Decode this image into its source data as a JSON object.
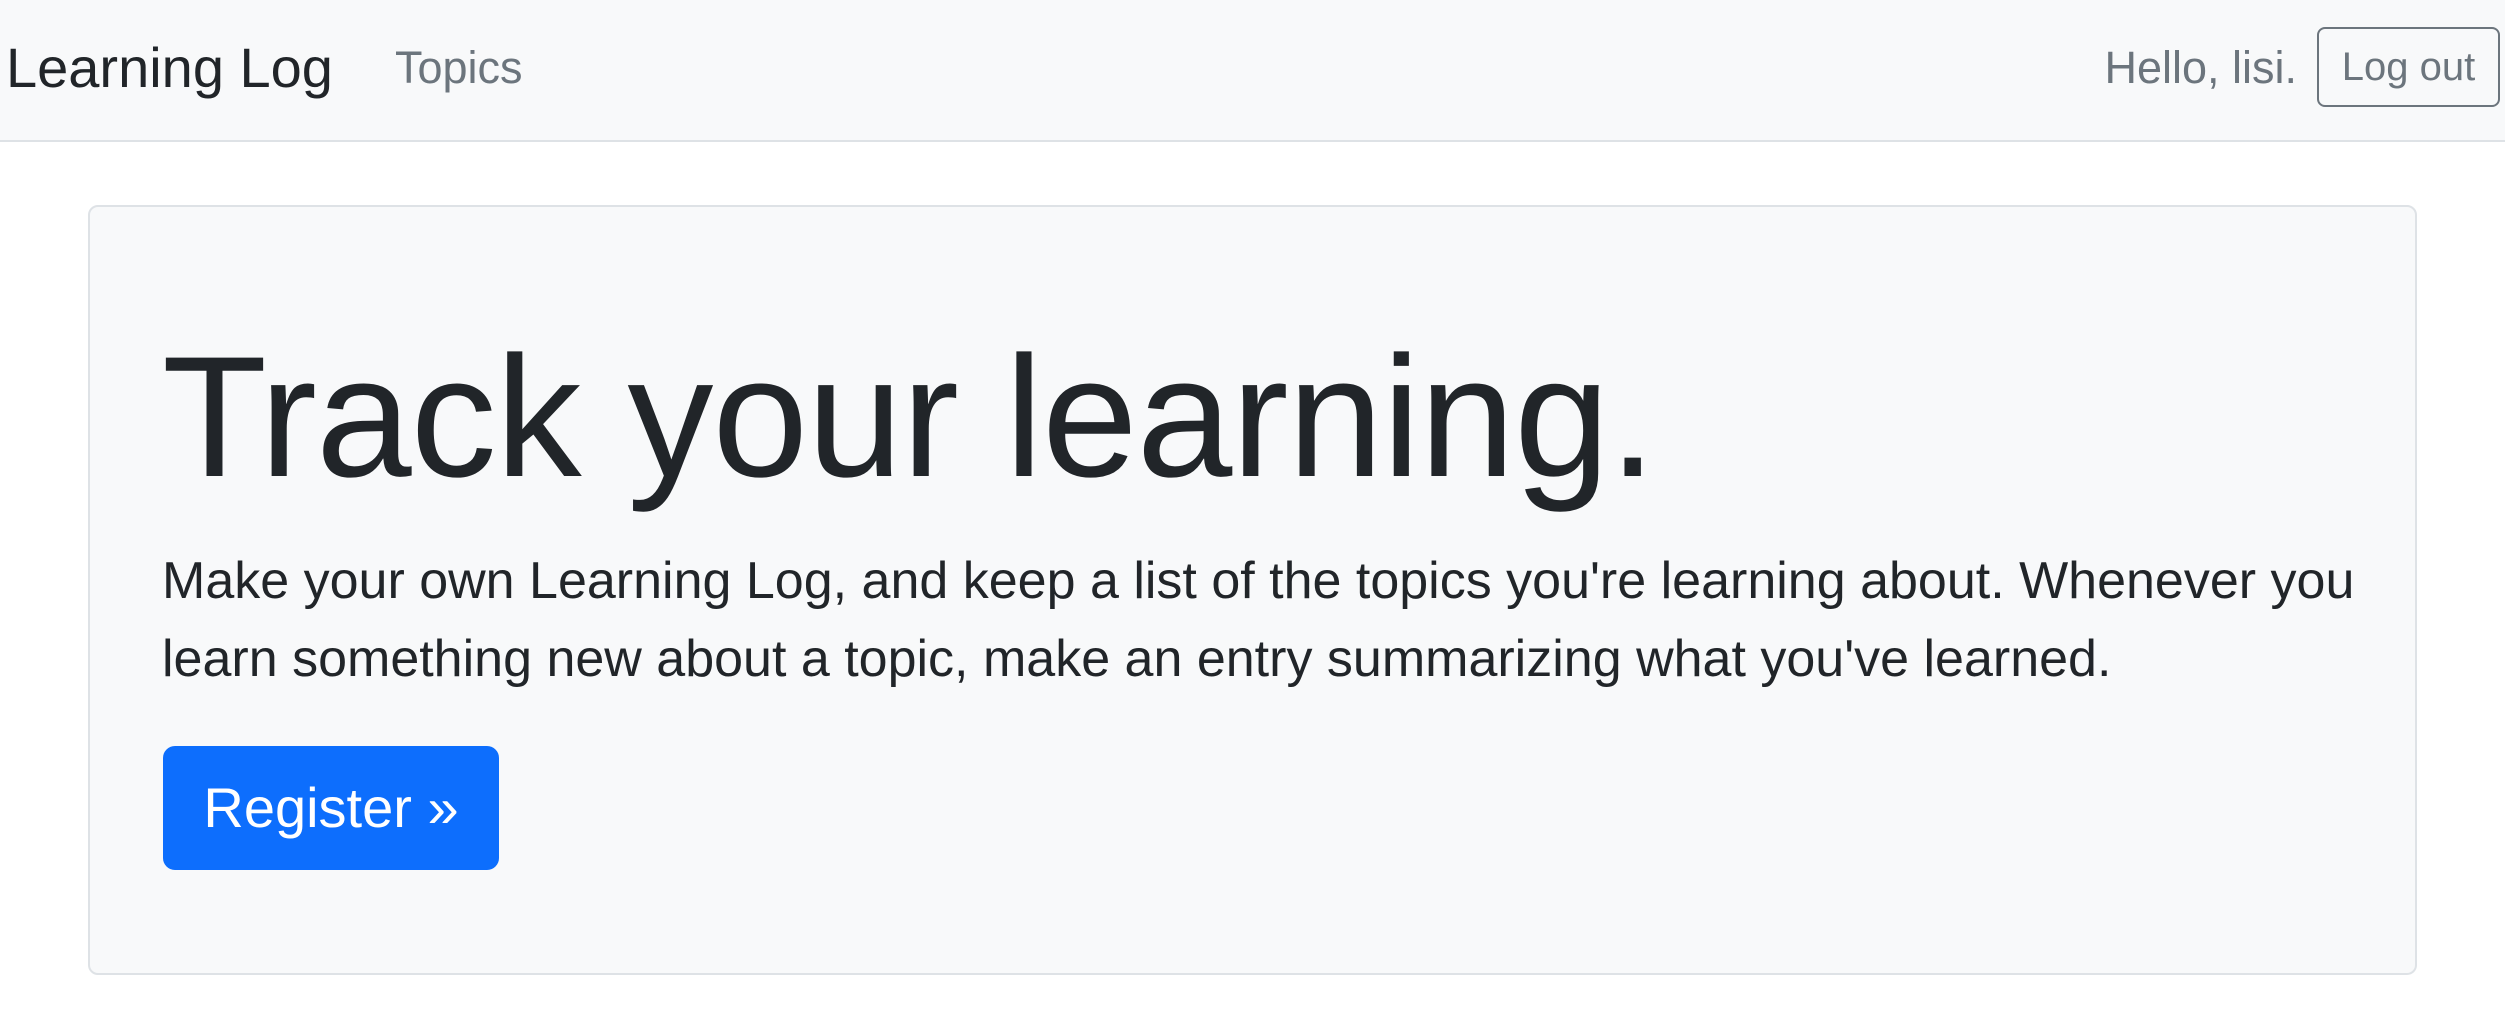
{
  "navbar": {
    "brand": "Learning Log",
    "links": [
      {
        "label": "Topics"
      }
    ],
    "greeting": "Hello, lisi.",
    "logout_label": "Log out"
  },
  "jumbotron": {
    "title": "Track your learning.",
    "lead": "Make your own Learning Log, and keep a list of the topics you're learning about. Whenever you learn something new about a topic, make an entry summarizing what you've learned.",
    "register_label": "Register »"
  },
  "colors": {
    "primary": "#0d6efd",
    "navbar_bg": "#f8f9fa",
    "muted": "#6c757d",
    "text": "#212529",
    "border": "#dee2e6"
  }
}
